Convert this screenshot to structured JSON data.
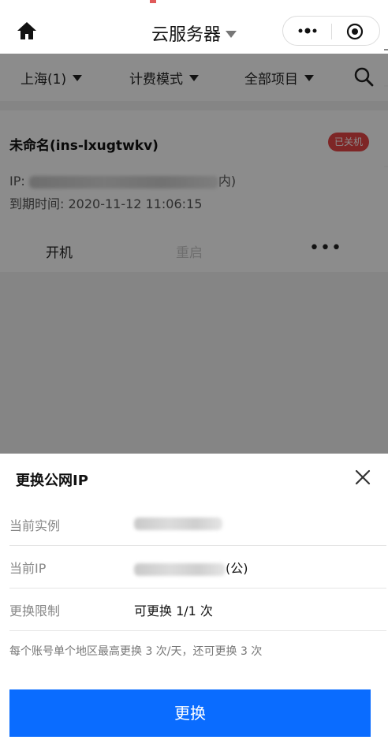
{
  "nav": {
    "title": "云服务器"
  },
  "filters": {
    "region": "上海(1)",
    "billing": "计费模式",
    "project": "全部项目"
  },
  "instance": {
    "name": "未命名(ins-lxugtwkv)",
    "status": "已关机",
    "ip_prefix": "IP: ",
    "ip_suffix": "内)",
    "expire": "到期时间: 2020-11-12 11:06:15"
  },
  "actions": {
    "start": "开机",
    "restart": "重启",
    "more": "•••"
  },
  "sheet": {
    "title": "更换公网IP",
    "rows": [
      {
        "label": "当前实例",
        "value": ""
      },
      {
        "label": "当前IP",
        "value": "(公)"
      },
      {
        "label": "更换限制",
        "value": "可更换 1/1 次"
      }
    ],
    "note": "每个账号单个地区最高更换 3 次/天，还可更换 3 次",
    "button": "更换"
  },
  "colors": {
    "primary": "#0a6cff",
    "status_stopped": "#e54545",
    "overlay": "rgba(0,0,0,0.45)"
  }
}
